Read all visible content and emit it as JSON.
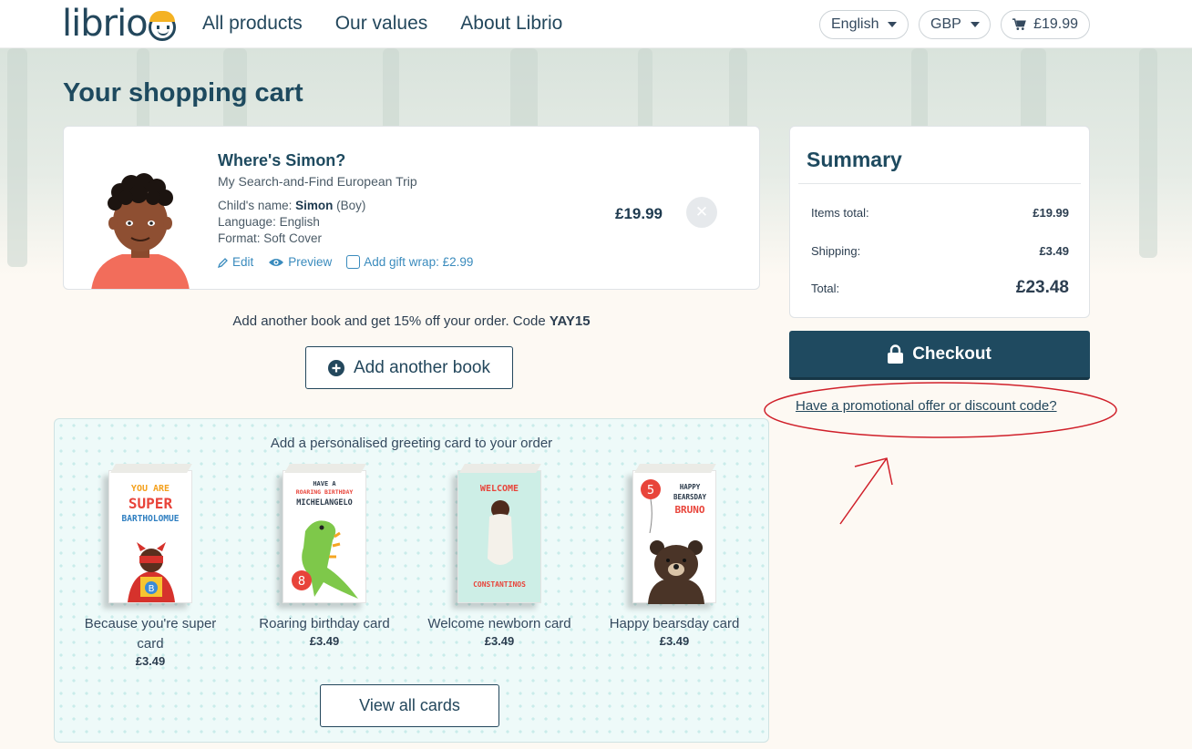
{
  "header": {
    "logo_text": "librio",
    "nav": [
      "All products",
      "Our values",
      "About Librio"
    ],
    "language": "English",
    "currency": "GBP",
    "cart_total": "£19.99"
  },
  "page": {
    "title": "Your shopping cart"
  },
  "cart_item": {
    "title": "Where's Simon?",
    "subtitle": "My Search-and-Find European Trip",
    "child_label": "Child's name:",
    "child_name": "Simon",
    "child_gender": "(Boy)",
    "language_line": "Language: English",
    "format_line": "Format: Soft Cover",
    "edit_label": "Edit",
    "preview_label": "Preview",
    "gift_wrap_label": "Add gift wrap: £2.99",
    "price": "£19.99"
  },
  "upsell": {
    "text": "Add another book and get 15% off your order. Code",
    "code": "YAY15",
    "button_label": "Add another book"
  },
  "summary": {
    "title": "Summary",
    "items_total_label": "Items total:",
    "items_total_value": "£19.99",
    "shipping_label": "Shipping:",
    "shipping_value": "£3.49",
    "total_label": "Total:",
    "total_value": "£23.48"
  },
  "checkout": {
    "button_label": "Checkout",
    "promo_link": "Have a promotional offer or discount code?"
  },
  "greeting_cards": {
    "title": "Add a personalised greeting card to your order",
    "view_all_label": "View all cards",
    "cards": [
      {
        "name": "Because you're super card",
        "price": "£3.49",
        "art_lines": [
          "YOU ARE",
          "SUPER",
          "BARTHOLOMUE"
        ]
      },
      {
        "name": "Roaring birthday card",
        "price": "£3.49",
        "art_lines": [
          "HAVE A",
          "ROARING BIRTHDAY",
          "MICHELANGELO"
        ]
      },
      {
        "name": "Welcome newborn card",
        "price": "£3.49",
        "art_lines": [
          "WELCOME",
          "CONSTANTINOS"
        ]
      },
      {
        "name": "Happy bearsday card",
        "price": "£3.49",
        "art_lines": [
          "HAPPY",
          "BEARSDAY",
          "BRUNO"
        ]
      }
    ]
  },
  "colors": {
    "brand_navy": "#1f4a60",
    "link_blue": "#3a8bbd",
    "annotation_red": "#d0202a"
  }
}
